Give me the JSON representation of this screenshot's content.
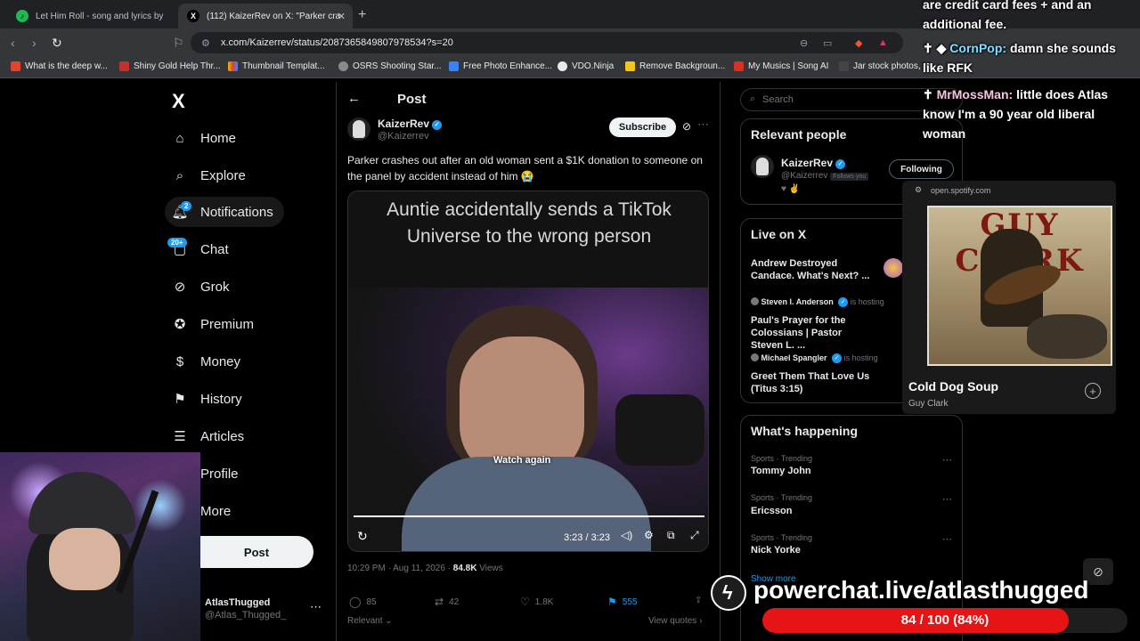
{
  "browser": {
    "tabs": [
      {
        "label": "Let Him Roll - song and lyrics by"
      },
      {
        "label": "(112) KaizerRev on X: \"Parker cra"
      }
    ],
    "url": "x.com/Kaizerrev/status/2087365849807978534?s=20",
    "bookmarks": [
      "What is the deep w...",
      "Shiny Gold Help Thr...",
      "Thumbnail Templat...",
      "OSRS Shooting Star...",
      "Free Photo Enhance...",
      "VDO.Ninja",
      "Remove Backgroun...",
      "My Musics | Song AI",
      "Jar stock photos, ro"
    ]
  },
  "nav": {
    "logo": "X",
    "items": [
      {
        "label": "Home",
        "icon": "home-icon"
      },
      {
        "label": "Explore",
        "icon": "search-icon"
      },
      {
        "label": "Notifications",
        "icon": "bell-icon",
        "badge": "2"
      },
      {
        "label": "Chat",
        "icon": "chat-icon",
        "badge": "20+"
      },
      {
        "label": "Grok",
        "icon": "grok-icon"
      },
      {
        "label": "Premium",
        "icon": "premium-icon"
      },
      {
        "label": "Money",
        "icon": "money-icon"
      },
      {
        "label": "History",
        "icon": "bookmark-icon"
      },
      {
        "label": "Articles",
        "icon": "articles-icon"
      },
      {
        "label": "Profile",
        "icon": "profile-icon"
      },
      {
        "label": "More",
        "icon": "more-icon"
      }
    ],
    "post_button": "Post",
    "account": {
      "name": "AtlasThugged",
      "handle": "@Atlas_Thugged_"
    }
  },
  "post": {
    "header": "Post",
    "author_name": "KaizerRev",
    "author_handle": "@Kaizerrev",
    "subscribe": "Subscribe",
    "text": "Parker crashes out after an old woman sent a $1K donation to someone on the panel by accident instead of him 😭",
    "video": {
      "caption": "Auntie accidentally sends a TikTok Universe to the wrong person",
      "watch_again": "Watch again",
      "time": "3:23 / 3:23",
      "progress": 1.0
    },
    "timestamp": "10:29 PM · Aug 11, 2026 · ",
    "views_count": "84.8K",
    "views_label": " Views",
    "stats": {
      "replies": "85",
      "reposts": "42",
      "likes": "1.8K",
      "bookmarks": "555"
    },
    "sort": "Relevant",
    "view_quotes": "View quotes"
  },
  "right": {
    "search_placeholder": "Search",
    "relevant_people": {
      "title": "Relevant people",
      "name": "KaizerRev",
      "handle": "@Kaizerrev",
      "follows_you": "Follows you",
      "button": "Following"
    },
    "live": {
      "title": "Live on X",
      "items": [
        {
          "host": "",
          "status": "",
          "title": "Andrew Destroyed Candace. What's Next? ..."
        },
        {
          "host": "Steven I. Anderson",
          "status": "is hosting",
          "title": "Paul's Prayer for the Colossians | Pastor Steven L. ..."
        },
        {
          "host": "Michael Spangler",
          "status": "is hosting",
          "title": "Greet Them That Love Us (Titus 3:15)"
        }
      ]
    },
    "happening": {
      "title": "What's happening",
      "trends": [
        {
          "category": "Sports · Trending",
          "name": "Tommy John"
        },
        {
          "category": "Sports · Trending",
          "name": "Ericsson"
        },
        {
          "category": "Sports · Trending",
          "name": "Nick Yorke"
        }
      ],
      "show_more": "Show more"
    }
  },
  "spotify": {
    "source": "open.spotify.com",
    "title": "Cold Dog Soup",
    "artist": "Guy Clark",
    "album_art_text": "GUY CLARK"
  },
  "chat_overlay": {
    "messages": [
      {
        "user": "",
        "text": "are credit card fees + and an additional fee."
      },
      {
        "user": "CornPop:",
        "text": "damn she sounds like RFK"
      },
      {
        "user": "MrMossMan:",
        "text": "little does Atlas know I'm a 90 year old liberal woman"
      }
    ],
    "powerchat": "powerchat.live/atlasthugged",
    "goal_text": "84 / 100 (84%)",
    "goal_fraction": 0.84
  },
  "colors": {
    "accent": "#1d9bf0",
    "goal": "#e61414",
    "background": "#000000"
  }
}
